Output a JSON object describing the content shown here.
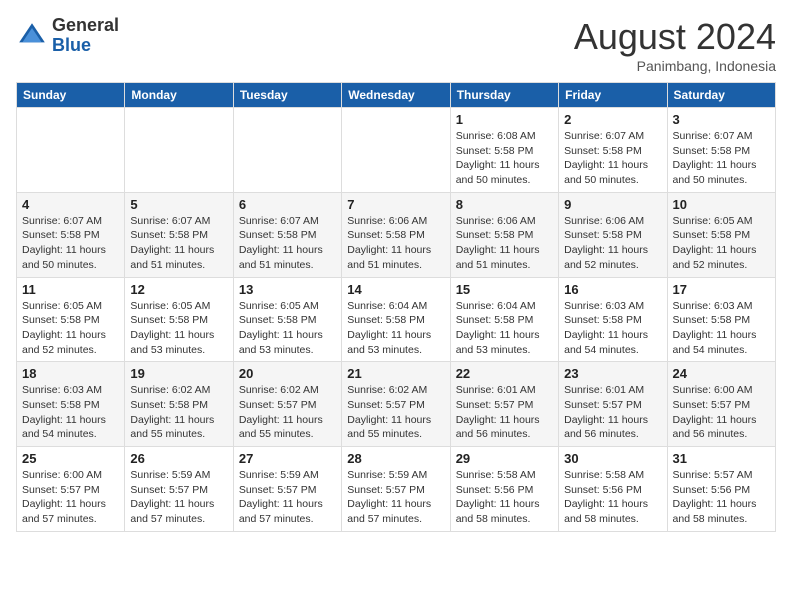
{
  "header": {
    "logo_general": "General",
    "logo_blue": "Blue",
    "month_year": "August 2024",
    "location": "Panimbang, Indonesia"
  },
  "weekdays": [
    "Sunday",
    "Monday",
    "Tuesday",
    "Wednesday",
    "Thursday",
    "Friday",
    "Saturday"
  ],
  "weeks": [
    [
      {
        "day": "",
        "sunrise": "",
        "sunset": "",
        "daylight": ""
      },
      {
        "day": "",
        "sunrise": "",
        "sunset": "",
        "daylight": ""
      },
      {
        "day": "",
        "sunrise": "",
        "sunset": "",
        "daylight": ""
      },
      {
        "day": "",
        "sunrise": "",
        "sunset": "",
        "daylight": ""
      },
      {
        "day": "1",
        "sunrise": "Sunrise: 6:08 AM",
        "sunset": "Sunset: 5:58 PM",
        "daylight": "Daylight: 11 hours and 50 minutes."
      },
      {
        "day": "2",
        "sunrise": "Sunrise: 6:07 AM",
        "sunset": "Sunset: 5:58 PM",
        "daylight": "Daylight: 11 hours and 50 minutes."
      },
      {
        "day": "3",
        "sunrise": "Sunrise: 6:07 AM",
        "sunset": "Sunset: 5:58 PM",
        "daylight": "Daylight: 11 hours and 50 minutes."
      }
    ],
    [
      {
        "day": "4",
        "sunrise": "Sunrise: 6:07 AM",
        "sunset": "Sunset: 5:58 PM",
        "daylight": "Daylight: 11 hours and 50 minutes."
      },
      {
        "day": "5",
        "sunrise": "Sunrise: 6:07 AM",
        "sunset": "Sunset: 5:58 PM",
        "daylight": "Daylight: 11 hours and 51 minutes."
      },
      {
        "day": "6",
        "sunrise": "Sunrise: 6:07 AM",
        "sunset": "Sunset: 5:58 PM",
        "daylight": "Daylight: 11 hours and 51 minutes."
      },
      {
        "day": "7",
        "sunrise": "Sunrise: 6:06 AM",
        "sunset": "Sunset: 5:58 PM",
        "daylight": "Daylight: 11 hours and 51 minutes."
      },
      {
        "day": "8",
        "sunrise": "Sunrise: 6:06 AM",
        "sunset": "Sunset: 5:58 PM",
        "daylight": "Daylight: 11 hours and 51 minutes."
      },
      {
        "day": "9",
        "sunrise": "Sunrise: 6:06 AM",
        "sunset": "Sunset: 5:58 PM",
        "daylight": "Daylight: 11 hours and 52 minutes."
      },
      {
        "day": "10",
        "sunrise": "Sunrise: 6:05 AM",
        "sunset": "Sunset: 5:58 PM",
        "daylight": "Daylight: 11 hours and 52 minutes."
      }
    ],
    [
      {
        "day": "11",
        "sunrise": "Sunrise: 6:05 AM",
        "sunset": "Sunset: 5:58 PM",
        "daylight": "Daylight: 11 hours and 52 minutes."
      },
      {
        "day": "12",
        "sunrise": "Sunrise: 6:05 AM",
        "sunset": "Sunset: 5:58 PM",
        "daylight": "Daylight: 11 hours and 53 minutes."
      },
      {
        "day": "13",
        "sunrise": "Sunrise: 6:05 AM",
        "sunset": "Sunset: 5:58 PM",
        "daylight": "Daylight: 11 hours and 53 minutes."
      },
      {
        "day": "14",
        "sunrise": "Sunrise: 6:04 AM",
        "sunset": "Sunset: 5:58 PM",
        "daylight": "Daylight: 11 hours and 53 minutes."
      },
      {
        "day": "15",
        "sunrise": "Sunrise: 6:04 AM",
        "sunset": "Sunset: 5:58 PM",
        "daylight": "Daylight: 11 hours and 53 minutes."
      },
      {
        "day": "16",
        "sunrise": "Sunrise: 6:03 AM",
        "sunset": "Sunset: 5:58 PM",
        "daylight": "Daylight: 11 hours and 54 minutes."
      },
      {
        "day": "17",
        "sunrise": "Sunrise: 6:03 AM",
        "sunset": "Sunset: 5:58 PM",
        "daylight": "Daylight: 11 hours and 54 minutes."
      }
    ],
    [
      {
        "day": "18",
        "sunrise": "Sunrise: 6:03 AM",
        "sunset": "Sunset: 5:58 PM",
        "daylight": "Daylight: 11 hours and 54 minutes."
      },
      {
        "day": "19",
        "sunrise": "Sunrise: 6:02 AM",
        "sunset": "Sunset: 5:58 PM",
        "daylight": "Daylight: 11 hours and 55 minutes."
      },
      {
        "day": "20",
        "sunrise": "Sunrise: 6:02 AM",
        "sunset": "Sunset: 5:57 PM",
        "daylight": "Daylight: 11 hours and 55 minutes."
      },
      {
        "day": "21",
        "sunrise": "Sunrise: 6:02 AM",
        "sunset": "Sunset: 5:57 PM",
        "daylight": "Daylight: 11 hours and 55 minutes."
      },
      {
        "day": "22",
        "sunrise": "Sunrise: 6:01 AM",
        "sunset": "Sunset: 5:57 PM",
        "daylight": "Daylight: 11 hours and 56 minutes."
      },
      {
        "day": "23",
        "sunrise": "Sunrise: 6:01 AM",
        "sunset": "Sunset: 5:57 PM",
        "daylight": "Daylight: 11 hours and 56 minutes."
      },
      {
        "day": "24",
        "sunrise": "Sunrise: 6:00 AM",
        "sunset": "Sunset: 5:57 PM",
        "daylight": "Daylight: 11 hours and 56 minutes."
      }
    ],
    [
      {
        "day": "25",
        "sunrise": "Sunrise: 6:00 AM",
        "sunset": "Sunset: 5:57 PM",
        "daylight": "Daylight: 11 hours and 57 minutes."
      },
      {
        "day": "26",
        "sunrise": "Sunrise: 5:59 AM",
        "sunset": "Sunset: 5:57 PM",
        "daylight": "Daylight: 11 hours and 57 minutes."
      },
      {
        "day": "27",
        "sunrise": "Sunrise: 5:59 AM",
        "sunset": "Sunset: 5:57 PM",
        "daylight": "Daylight: 11 hours and 57 minutes."
      },
      {
        "day": "28",
        "sunrise": "Sunrise: 5:59 AM",
        "sunset": "Sunset: 5:57 PM",
        "daylight": "Daylight: 11 hours and 57 minutes."
      },
      {
        "day": "29",
        "sunrise": "Sunrise: 5:58 AM",
        "sunset": "Sunset: 5:56 PM",
        "daylight": "Daylight: 11 hours and 58 minutes."
      },
      {
        "day": "30",
        "sunrise": "Sunrise: 5:58 AM",
        "sunset": "Sunset: 5:56 PM",
        "daylight": "Daylight: 11 hours and 58 minutes."
      },
      {
        "day": "31",
        "sunrise": "Sunrise: 5:57 AM",
        "sunset": "Sunset: 5:56 PM",
        "daylight": "Daylight: 11 hours and 58 minutes."
      }
    ]
  ]
}
